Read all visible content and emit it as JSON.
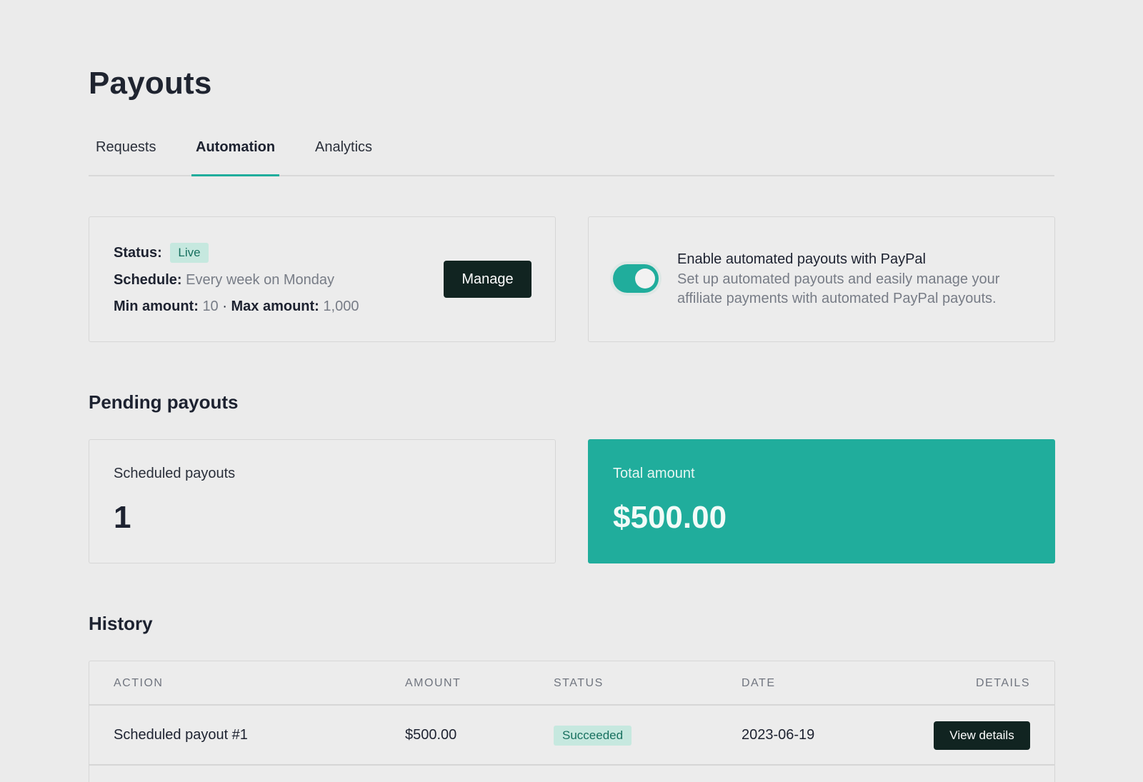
{
  "page": {
    "title": "Payouts"
  },
  "tabs": [
    {
      "label": "Requests",
      "active": false
    },
    {
      "label": "Automation",
      "active": true
    },
    {
      "label": "Analytics",
      "active": false
    }
  ],
  "automation": {
    "status_label": "Status:",
    "status_value": "Live",
    "schedule_label": "Schedule:",
    "schedule_value": "Every week on Monday",
    "min_label": "Min amount:",
    "min_value": "10",
    "separator": "·",
    "max_label": "Max amount:",
    "max_value": "1,000",
    "manage_label": "Manage"
  },
  "paypal": {
    "enabled": true,
    "title": "Enable automated payouts with PayPal",
    "description": "Set up automated payouts and easily manage your affiliate payments with automated PayPal payouts."
  },
  "pending": {
    "title": "Pending payouts",
    "scheduled_label": "Scheduled payouts",
    "scheduled_value": "1",
    "total_label": "Total amount",
    "total_value": "$500.00"
  },
  "history": {
    "title": "History",
    "columns": [
      "Action",
      "Amount",
      "Status",
      "Date",
      "Details"
    ],
    "rows": [
      {
        "action": "Scheduled payout #1",
        "amount": "$500.00",
        "status": "Succeeded",
        "date": "2023-06-19",
        "details_label": "View details"
      }
    ]
  },
  "colors": {
    "accent": "#20ad9c",
    "dark_button": "#112421",
    "badge_bg": "#c6e8df",
    "badge_text": "#17705f",
    "background": "#ebebeb"
  }
}
